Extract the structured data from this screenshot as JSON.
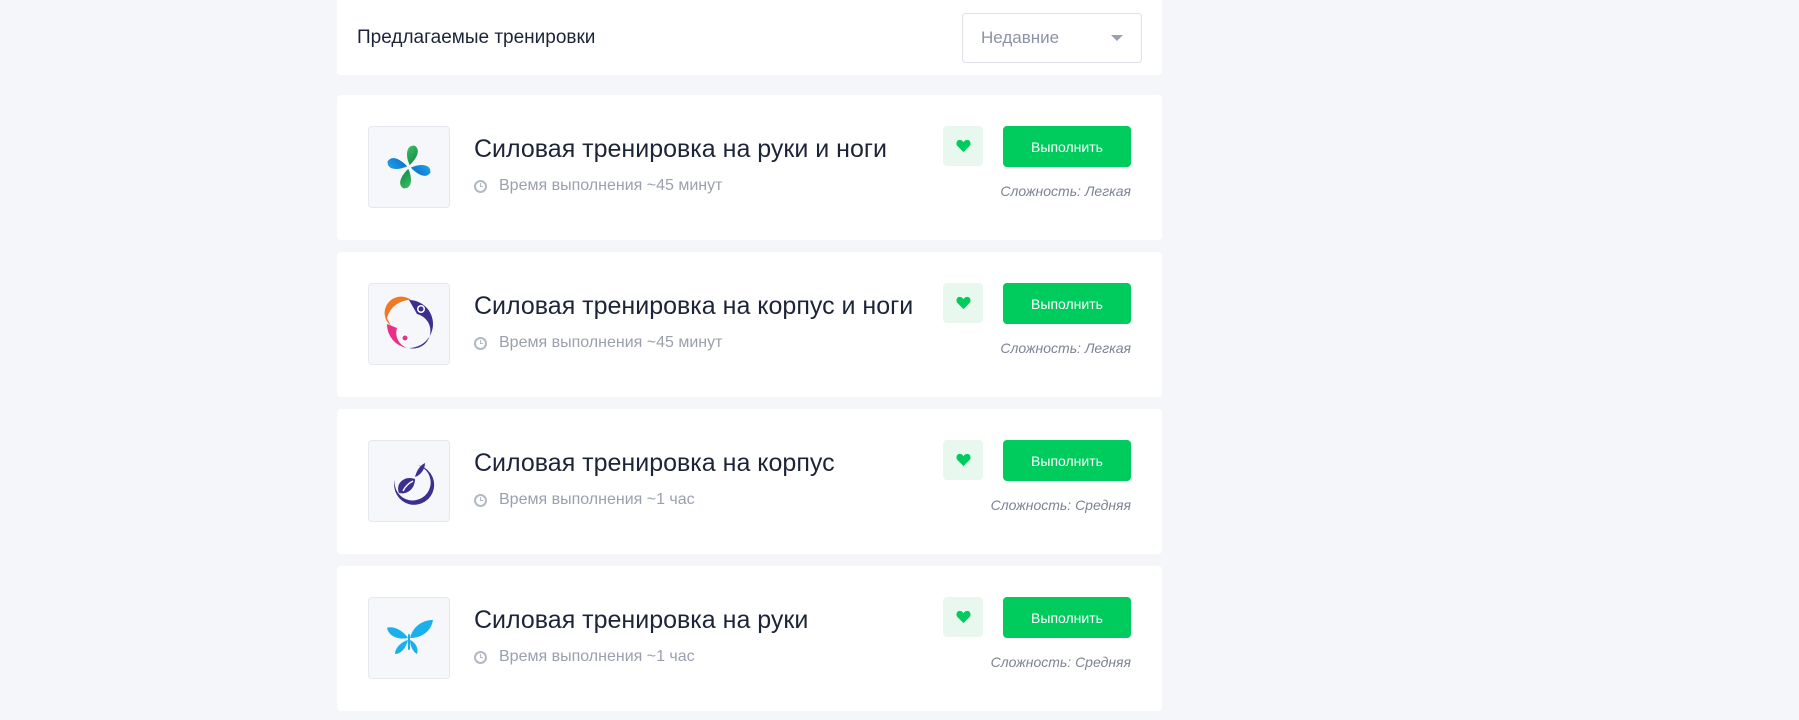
{
  "header": {
    "title": "Предлагаемые тренировки",
    "sort_selected": "Недавние"
  },
  "workouts": [
    {
      "logo": "clover-logo",
      "title": "Силовая тренировка на руки и ноги",
      "duration": "Время выполнения ~45 минут",
      "button_label": "Выполнить",
      "difficulty": "Сложность: Легкая"
    },
    {
      "logo": "people-circle-logo",
      "title": "Силовая тренировка на корпус и ноги",
      "duration": "Время выполнения ~45 минут",
      "button_label": "Выполнить",
      "difficulty": "Сложность: Легкая"
    },
    {
      "logo": "leaf-ring-logo",
      "title": "Силовая тренировка на корпус",
      "duration": "Время выполнения ~1 час",
      "button_label": "Выполнить",
      "difficulty": "Сложность: Средняя"
    },
    {
      "logo": "butterfly-logo",
      "title": "Силовая тренировка на руки",
      "duration": "Время выполнения ~1 час",
      "button_label": "Выполнить",
      "difficulty": "Сложность: Средняя"
    }
  ],
  "colors": {
    "accent": "#00cc5e",
    "favorite_bg": "#e9f8ef",
    "page_bg": "#f5f6fa"
  }
}
